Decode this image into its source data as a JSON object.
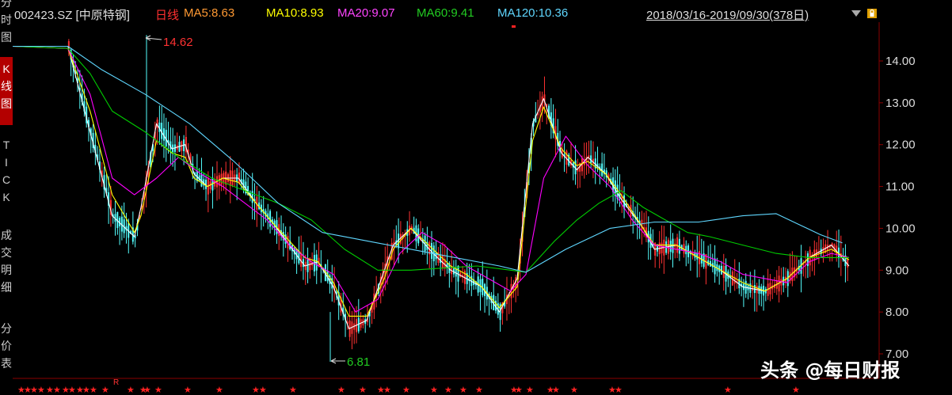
{
  "sidebar": {
    "tabs": [
      {
        "label": "分\n时\n图",
        "active": false
      },
      {
        "label": "K\n线\n图",
        "active": true
      },
      {
        "label": "T\nI\nC\nK",
        "active": false
      },
      {
        "label": "成\n交\n明\n细",
        "active": false
      },
      {
        "label": "分\n价\n表",
        "active": false
      }
    ]
  },
  "header": {
    "stock": "002423.SZ [中原特钢]",
    "period": "日线",
    "ma5": "MA5:8.63",
    "ma10": "MA10:8.93",
    "ma20": "MA20:9.07",
    "ma60": "MA60:9.41",
    "ma120": "MA120:10.36",
    "date_range": "2018/03/16-2019/09/30(378日)"
  },
  "colors": {
    "up": "#ff3232",
    "down": "#54ffff",
    "ma5": "#ffffff",
    "ma10": "#ffff00",
    "ma20": "#ff00ff",
    "ma60": "#00cc00",
    "ma120": "#5fd7ff",
    "period": "#ff3030",
    "header_ma5": "#ff9933"
  },
  "annotations": {
    "high": "14.62",
    "low": "6.81",
    "r_mark": "R"
  },
  "watermark": "头条 @每日财报",
  "chart_data": {
    "type": "line",
    "title": "002423.SZ [中原特钢] 日线",
    "x_range": [
      "2018/03/16",
      "2019/09/30"
    ],
    "ylim": [
      6.6,
      14.8
    ],
    "y_ticks": [
      "14.00",
      "13.00",
      "12.00",
      "11.00",
      "10.00",
      "9.00",
      "8.00",
      "7.00"
    ],
    "grid": false,
    "highest": 14.62,
    "lowest": 6.81,
    "series": [
      {
        "name": "MA5",
        "x": [
          0,
          25,
          35,
          45,
          55,
          58,
          65,
          72,
          78,
          82,
          88,
          95,
          102,
          110,
          118,
          125,
          132,
          138,
          145,
          152,
          160,
          168,
          172,
          180,
          190,
          198,
          205,
          212,
          220,
          228,
          235,
          240,
          248,
          255,
          260,
          268,
          275,
          285,
          290,
          300,
          310,
          320,
          330,
          340,
          350,
          360,
          370,
          378
        ],
        "values": [
          14.35,
          14.35,
          12.3,
          10.3,
          9.8,
          10.5,
          12.5,
          11.9,
          12.0,
          11.3,
          11.0,
          11.2,
          11.2,
          10.6,
          10.1,
          9.6,
          9.1,
          9.2,
          8.6,
          7.6,
          7.8,
          9.0,
          9.6,
          10.0,
          9.4,
          9.0,
          8.8,
          8.6,
          8.0,
          8.8,
          12.5,
          13.1,
          11.8,
          11.4,
          11.7,
          11.3,
          10.7,
          10.0,
          9.5,
          9.6,
          9.3,
          9.0,
          8.6,
          8.5,
          8.8,
          9.3,
          9.6,
          9.1
        ]
      },
      {
        "name": "MA10",
        "x": [
          0,
          25,
          35,
          45,
          55,
          58,
          65,
          72,
          78,
          82,
          88,
          95,
          102,
          110,
          118,
          125,
          132,
          138,
          145,
          152,
          160,
          168,
          172,
          180,
          190,
          198,
          205,
          212,
          220,
          228,
          235,
          240,
          248,
          255,
          260,
          268,
          275,
          285,
          290,
          300,
          310,
          320,
          330,
          340,
          350,
          360,
          370,
          378
        ],
        "values": [
          14.35,
          14.3,
          12.8,
          10.8,
          9.9,
          10.3,
          12.1,
          11.8,
          11.7,
          11.2,
          11.0,
          11.2,
          11.1,
          10.6,
          10.1,
          9.7,
          9.3,
          9.2,
          8.7,
          7.9,
          7.9,
          8.8,
          9.5,
          10.0,
          9.5,
          9.1,
          8.9,
          8.6,
          8.1,
          8.6,
          12.1,
          12.9,
          11.9,
          11.5,
          11.6,
          11.3,
          10.8,
          10.0,
          9.6,
          9.6,
          9.3,
          9.0,
          8.7,
          8.5,
          8.8,
          9.3,
          9.5,
          9.25
        ]
      },
      {
        "name": "MA20",
        "x": [
          0,
          25,
          35,
          45,
          55,
          65,
          75,
          85,
          95,
          105,
          115,
          125,
          135,
          145,
          155,
          165,
          175,
          185,
          195,
          205,
          215,
          225,
          232,
          240,
          250,
          260,
          270,
          280,
          290,
          300,
          310,
          320,
          330,
          340,
          350,
          360,
          370,
          378
        ],
        "values": [
          14.35,
          14.3,
          13.2,
          11.2,
          10.8,
          11.2,
          11.7,
          11.3,
          11.0,
          10.6,
          10.2,
          9.6,
          9.2,
          8.9,
          8.0,
          8.3,
          9.4,
          9.9,
          9.6,
          9.1,
          8.8,
          8.5,
          8.9,
          11.2,
          12.2,
          11.5,
          11.0,
          10.2,
          9.6,
          9.5,
          9.4,
          9.2,
          8.9,
          8.8,
          8.7,
          9.2,
          9.4,
          9.3
        ]
      },
      {
        "name": "MA60",
        "x": [
          0,
          25,
          35,
          45,
          60,
          75,
          90,
          105,
          120,
          135,
          150,
          165,
          180,
          195,
          210,
          225,
          232,
          245,
          255,
          265,
          275,
          285,
          295,
          305,
          315,
          330,
          345,
          360,
          378
        ],
        "values": [
          14.35,
          14.3,
          13.7,
          12.8,
          12.3,
          11.7,
          11.2,
          10.9,
          10.6,
          10.2,
          9.5,
          9.0,
          9.0,
          9.05,
          9.1,
          9.0,
          8.95,
          9.7,
          10.2,
          10.6,
          10.9,
          10.5,
          10.2,
          9.9,
          9.8,
          9.6,
          9.4,
          9.3,
          9.3
        ]
      },
      {
        "name": "MA120",
        "x": [
          0,
          25,
          40,
          60,
          80,
          100,
          120,
          140,
          160,
          180,
          200,
          220,
          232,
          250,
          270,
          290,
          310,
          330,
          345,
          355,
          365,
          375
        ],
        "values": [
          14.35,
          14.35,
          13.8,
          13.2,
          12.5,
          11.6,
          10.6,
          9.9,
          9.7,
          9.5,
          9.3,
          9.1,
          8.95,
          9.5,
          10.0,
          10.15,
          10.15,
          10.3,
          10.35,
          10.1,
          9.85,
          9.65
        ]
      }
    ]
  }
}
